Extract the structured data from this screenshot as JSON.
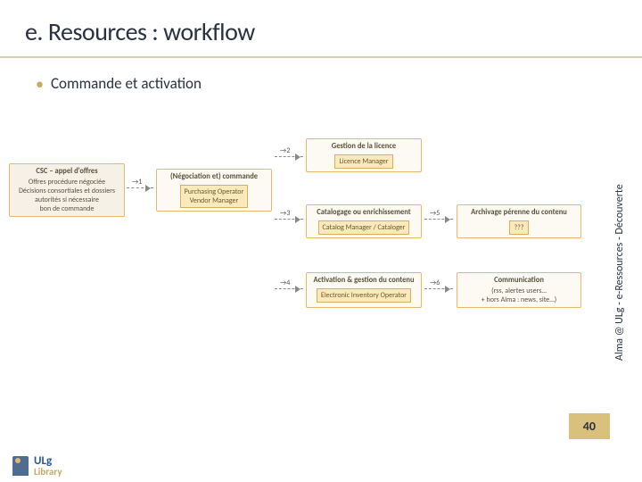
{
  "title": "e. Resources : workflow",
  "bullet": "Commande et activation",
  "sidebar_text": "Alma @ ULg - e-Ressources - Découverte",
  "page_number": "40",
  "logo": {
    "line1": "ULg",
    "line2": "Library"
  },
  "nodes": {
    "csc": {
      "title": "CSC – appel d'offres",
      "body": "Offres procédure négociée\nDécisions consortiales et dossiers autorités si nécessaire\nbon de commande"
    },
    "commande": {
      "title": "(Négociation et) commande",
      "role": "Purchasing Operator\nVendor Manager"
    },
    "licence": {
      "title": "Gestion de la licence",
      "role": "Licence Manager"
    },
    "catalog": {
      "title": "Catalogage ou enrichissement",
      "role": "Catalog Manager / Cataloger"
    },
    "activation": {
      "title": "Activation & gestion du contenu",
      "role": "Electronic Inventory Operator"
    },
    "archivage": {
      "title": "Archivage pérenne du contenu",
      "role": "???"
    },
    "communication": {
      "title": "Communication",
      "body": "(rss, alertes users…\n+ hors Alma : news, site…)"
    }
  },
  "arrows": {
    "a1": "→1",
    "a2": "→2",
    "a3": "→3",
    "a4": "→4",
    "a5": "→5",
    "a6": "→6"
  },
  "chart_data": {
    "type": "workflow",
    "steps": [
      {
        "id": "csc",
        "label": "CSC – appel d'offres",
        "details": "Offres procédure négociée; Décisions consortiales et dossiers autorités si nécessaire; bon de commande"
      },
      {
        "id": "commande",
        "label": "(Négociation et) commande",
        "roles": [
          "Purchasing Operator",
          "Vendor Manager"
        ]
      },
      {
        "id": "licence",
        "label": "Gestion de la licence",
        "roles": [
          "Licence Manager"
        ]
      },
      {
        "id": "catalog",
        "label": "Catalogage ou enrichissement",
        "roles": [
          "Catalog Manager",
          "Cataloger"
        ]
      },
      {
        "id": "activation",
        "label": "Activation & gestion du contenu",
        "roles": [
          "Electronic Inventory Operator"
        ]
      },
      {
        "id": "archivage",
        "label": "Archivage pérenne du contenu",
        "roles": [
          "???"
        ]
      },
      {
        "id": "communication",
        "label": "Communication",
        "details": "(rss, alertes users… + hors Alma : news, site…)"
      }
    ],
    "edges": [
      {
        "from": "csc",
        "to": "commande",
        "order": 1
      },
      {
        "from": "commande",
        "to": "licence",
        "order": 2
      },
      {
        "from": "licence",
        "to": "catalog",
        "order": 3
      },
      {
        "from": "catalog",
        "to": "activation",
        "order": 4
      },
      {
        "from": "activation",
        "to": "archivage",
        "order": 5
      },
      {
        "from": "activation",
        "to": "communication",
        "order": 6
      }
    ]
  }
}
